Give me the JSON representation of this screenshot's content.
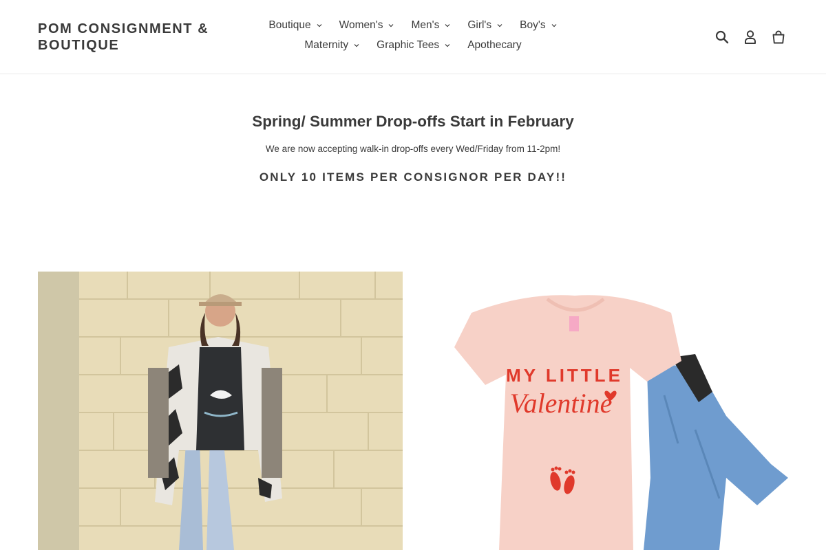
{
  "store": {
    "name": "POM CONSIGNMENT & BOUTIQUE"
  },
  "nav": {
    "items": [
      {
        "label": "Boutique",
        "has_dropdown": true
      },
      {
        "label": "Women's",
        "has_dropdown": true
      },
      {
        "label": "Men's",
        "has_dropdown": true
      },
      {
        "label": "Girl's",
        "has_dropdown": true
      },
      {
        "label": "Boy's",
        "has_dropdown": true
      },
      {
        "label": "Maternity",
        "has_dropdown": true
      },
      {
        "label": "Graphic Tees",
        "has_dropdown": true
      },
      {
        "label": "Apothecary",
        "has_dropdown": false
      }
    ]
  },
  "header_icons": [
    "search-icon",
    "account-icon",
    "cart-icon"
  ],
  "hero": {
    "title": "Spring/ Summer Drop-offs Start in February",
    "subtitle": "We are now accepting walk-in drop-offs every Wed/Friday from 11-2pm!",
    "note": "ONLY 10 ITEMS PER CONSIGNOR PER DAY!!"
  },
  "collections": [
    {
      "image": "woman in aztec-print jacket against brick wall"
    },
    {
      "image": "pink maternity tee with jeans",
      "tee_line1": "MY LITTLE",
      "tee_line2": "Valentine"
    }
  ],
  "colors": {
    "text": "#3a3a3a",
    "border": "#e8e8e8",
    "tee_print": "#e0392b"
  }
}
